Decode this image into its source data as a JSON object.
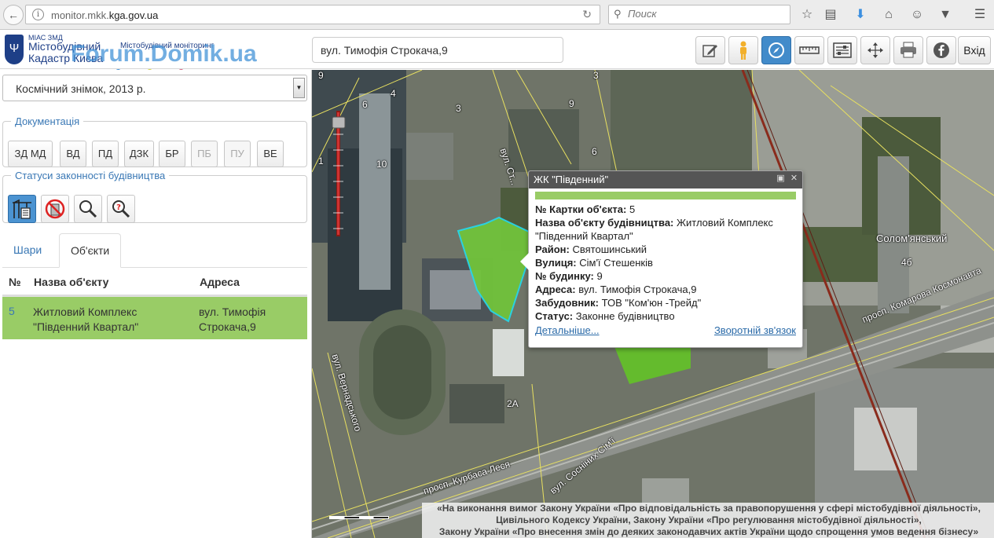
{
  "browser": {
    "url_prefix": "monitor.mkk.",
    "url_domain": "kga.gov.ua",
    "search_placeholder": "Поиск"
  },
  "header": {
    "logo_small": "МІАС ЗМД",
    "logo_line1": "Містобудівний",
    "logo_line2": "Кадастр Києва",
    "logo_sub": "Містобудівний моніторинг",
    "watermark": "Forum.Domik.ua",
    "address_value": "вул. Тимофія Строкача,9",
    "login_label": "Вхід",
    "dot_colors": [
      "#3d8fd6",
      "#d6d63d",
      "#d65a7a"
    ]
  },
  "left": {
    "layer_select": "Космічний знімок, 2013 р.",
    "docs_legend": "Документація",
    "docs": [
      "ЗД МД",
      "ВД",
      "ПД",
      "ДЗК",
      "БР",
      "ПБ",
      "ПУ",
      "ВЕ"
    ],
    "status_legend": "Статуси законності будівництва",
    "tabs": {
      "layers": "Шари",
      "objects": "Об'єкти"
    },
    "table": {
      "col_num": "№",
      "col_name": "Назва об'єкту",
      "col_addr": "Адреса",
      "rows": [
        {
          "num": "5",
          "name": "Житловий Комплекс \"Південний Квартал\"",
          "addr": "вул. Тимофія Строкача,9"
        }
      ]
    }
  },
  "map": {
    "labels": {
      "l9a": "9",
      "l6": "6",
      "l4": "4",
      "l3": "3",
      "l3b": "3",
      "l9b": "9",
      "l6b": "6",
      "l1": "1",
      "l10": "10",
      "l4b": "4б",
      "l2a": "2А",
      "district": "Солом'янський",
      "street_stroka": "вул. Ст...",
      "street_vernad": "вул. Вернадського",
      "street_kurbas": "просп. Курбаса Леся",
      "street_sosnin": "вул. Сосніних Сім'ї",
      "street_komar": "просп. Комарова Космонавта"
    },
    "popup": {
      "title": "ЖК \"Південний\"",
      "k_card": "№ Картки об'єкта:",
      "v_card": "5",
      "k_name": "Назва об'єкту будівництва:",
      "v_name": "Житловий Комплекс \"Південний Квартал\"",
      "k_district": "Район:",
      "v_district": "Святошинський",
      "k_street": "Вулиця:",
      "v_street": "Сім'ї Стешенків",
      "k_house": "№ будинку:",
      "v_house": "9",
      "k_address": "Адреса:",
      "v_address": "вул. Тимофія Строкача,9",
      "k_builder": "Забудовник:",
      "v_builder": "ТОВ \"Ком'юн -Трейд\"",
      "k_status": "Статус:",
      "v_status": "Законне будівництво",
      "link_more": "Детальніше...",
      "link_feedback": "Зворотній зв'язок"
    },
    "legal": [
      "«На виконання вимог Закону України «Про відповідальність за правопорушення у сфері містобудівної діяльності»,",
      "Цивільного Кодексу України, Закону України «Про регулювання містобудівної діяльності»,",
      "Закону України «Про внесення змін до деяких законодавчих актів України щодо спрощення умов ведення бізнесу»"
    ]
  }
}
